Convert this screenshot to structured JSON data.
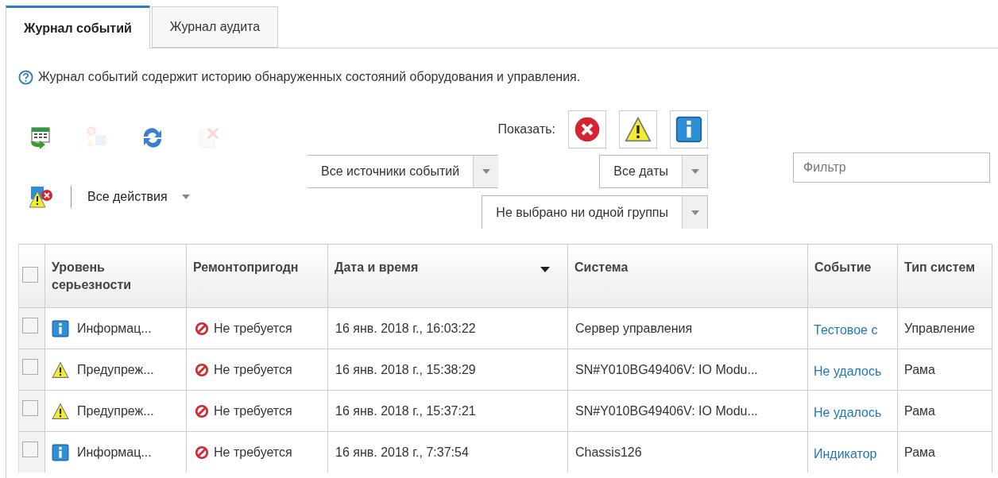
{
  "tabs": [
    {
      "label": "Журнал событий",
      "selected": true
    },
    {
      "label": "Журнал аудита",
      "selected": false
    }
  ],
  "help_text": "Журнал событий содержит историю обнаруженных состояний оборудования и управления.",
  "toolbar": {
    "buttons": [
      {
        "kind": "export",
        "disabled": false
      },
      {
        "kind": "exclude",
        "disabled": true
      },
      {
        "kind": "refresh",
        "disabled": false
      },
      {
        "kind": "clear",
        "disabled": true
      },
      {
        "kind": "severity",
        "disabled": false
      }
    ],
    "actions_menu": "Все действия"
  },
  "show_label": "Показать:",
  "show_filters": [
    {
      "kind": "error"
    },
    {
      "kind": "warning"
    },
    {
      "kind": "info"
    }
  ],
  "dropdowns": [
    {
      "value": "Все источники событий"
    },
    {
      "value": "Все даты"
    },
    {
      "value": "Не выбрано ни одной группы"
    }
  ],
  "filter": {
    "placeholder": "Фильтр"
  },
  "table": {
    "select_all_checked": false,
    "columns": [
      "Уровень серьезности",
      "Ремонтопригодн",
      "Дата и время",
      "Система",
      "Событие",
      "Тип систем"
    ],
    "rows": [
      {
        "checked": false,
        "kind": "info",
        "severity": "Информац...",
        "serviceability": "Не требуется",
        "date": "16 янв. 2018 г., 16:03:22",
        "system": "Сервер управления",
        "event": "Тестовое с",
        "system_type": "Управление"
      },
      {
        "checked": false,
        "kind": "warning",
        "severity": "Предупреж...",
        "serviceability": "Не требуется",
        "date": "16 янв. 2018 г., 15:38:29",
        "system": "SN#Y010BG49406V: IO Modu...",
        "event": "Не удалось",
        "system_type": "Рама"
      },
      {
        "checked": false,
        "kind": "warning",
        "severity": "Предупреж...",
        "serviceability": "Не требуется",
        "date": "16 янв. 2018 г., 15:37:21",
        "system": "SN#Y010BG49406V: IO Modu...",
        "event": "Не удалось",
        "system_type": "Рама"
      },
      {
        "checked": false,
        "kind": "info",
        "severity": "Информац...",
        "serviceability": "Не требуется",
        "date": "16 янв. 2018 г., 7:37:54",
        "system": "Chassis126",
        "event": "Индикатор",
        "system_type": "Рама"
      }
    ]
  }
}
